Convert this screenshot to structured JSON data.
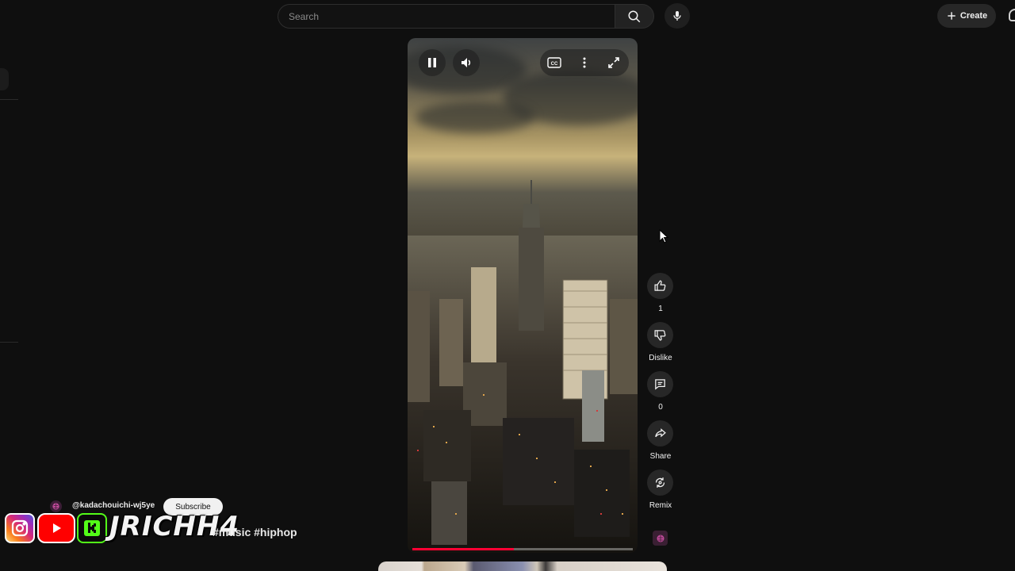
{
  "header": {
    "search_placeholder": "Search",
    "create_label": "Create",
    "icons": [
      "search-icon",
      "mic-icon",
      "plus-icon",
      "bell-icon"
    ]
  },
  "player": {
    "state": "playing",
    "progress_fraction": 0.46,
    "controls": [
      "pause-icon",
      "volume-icon",
      "captions-icon",
      "more-vert-icon",
      "fullscreen-icon"
    ]
  },
  "actions": {
    "like_count": "1",
    "dislike_label": "Dislike",
    "comment_count": "0",
    "share_label": "Share",
    "remix_label": "Remix"
  },
  "channel": {
    "handle": "@kadachouichi-wj5ye",
    "subscribe_label": "Subscribe",
    "hashtags": "#music #hiphop"
  },
  "overlay": {
    "brand": "JRICHH4",
    "socials": [
      "instagram-logo",
      "youtube-logo",
      "kick-logo"
    ]
  },
  "colors": {
    "background": "#0f0f0f",
    "progress": "#ff0033",
    "button_bg": "#272727",
    "instagram": "#d6249f",
    "youtube": "#ff0000",
    "kick": "#53fc18"
  }
}
